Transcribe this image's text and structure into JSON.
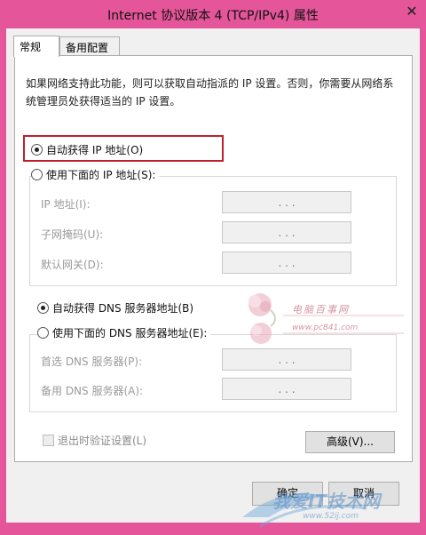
{
  "window": {
    "title": "Internet 协议版本 4 (TCP/IPv4) 属性",
    "close_glyph": "✕"
  },
  "tabs": [
    {
      "label": "常规",
      "active": true
    },
    {
      "label": "备用配置",
      "active": false
    }
  ],
  "description": "如果网络支持此功能，则可以获取自动指派的 IP 设置。否则，你需要从网络系统管理员处获得适当的 IP 设置。",
  "ip_section": {
    "auto_label": "自动获得 IP 地址(O)",
    "auto_checked": true,
    "manual_label": "使用下面的 IP 地址(S):",
    "fields": [
      {
        "label": "IP 地址(I):",
        "value": ". . ."
      },
      {
        "label": "子网掩码(U):",
        "value": ". . ."
      },
      {
        "label": "默认网关(D):",
        "value": ". . ."
      }
    ]
  },
  "dns_section": {
    "auto_label": "自动获得 DNS 服务器地址(B)",
    "auto_checked": true,
    "manual_label": "使用下面的 DNS 服务器地址(E):",
    "fields": [
      {
        "label": "首选 DNS 服务器(P):",
        "value": ". . ."
      },
      {
        "label": "备用 DNS 服务器(A):",
        "value": ". . ."
      }
    ]
  },
  "validate_label": "退出时验证设置(L)",
  "buttons": {
    "advanced": "高级(V)...",
    "ok": "确定",
    "cancel": "取消"
  },
  "watermarks": {
    "top_text": "电脑百事网",
    "top_url": "www.pc841.com",
    "bottom_text": "我爱IT技术网",
    "bottom_url": "www.52ij.com"
  },
  "colors": {
    "titlebar": "#e4559a",
    "highlight_border": "#c0202c"
  }
}
